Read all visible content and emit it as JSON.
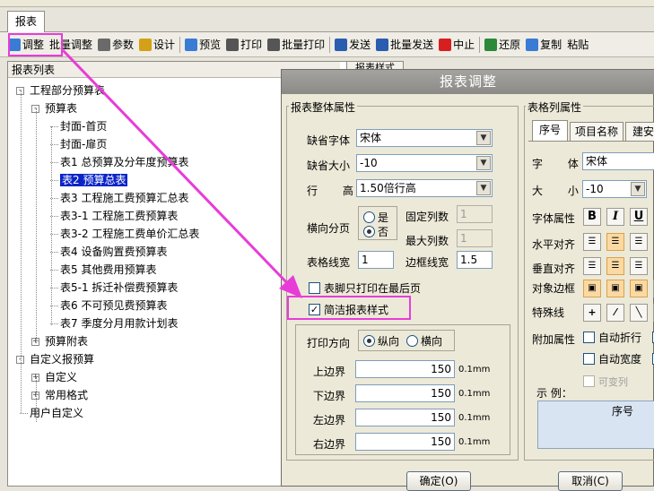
{
  "tab": {
    "title": "报表"
  },
  "toolbar": {
    "items": [
      {
        "label": "调整",
        "icon": "adjust-icon"
      },
      {
        "label": "批量调整",
        "icon": ""
      },
      {
        "label": "参数",
        "icon": "param-icon"
      },
      {
        "label": "设计",
        "icon": "pencil-icon"
      },
      {
        "label": "预览",
        "icon": "preview-icon"
      },
      {
        "label": "打印",
        "icon": "printer-icon"
      },
      {
        "label": "批量打印",
        "icon": "printer-icon"
      },
      {
        "label": "发送",
        "icon": "arrow-right-icon"
      },
      {
        "label": "批量发送",
        "icon": "double-arrow-icon"
      },
      {
        "label": "中止",
        "icon": "stop-icon"
      },
      {
        "label": "还原",
        "icon": "restore-icon"
      },
      {
        "label": "复制",
        "icon": "copy-icon"
      },
      {
        "label": "粘贴",
        "icon": ""
      }
    ]
  },
  "left": {
    "header": "报表列表",
    "tree": [
      {
        "label": "工程部分预算表",
        "level": 0,
        "exp": "-"
      },
      {
        "label": "预算表",
        "level": 1,
        "exp": "-"
      },
      {
        "label": "封面-首页",
        "level": 2,
        "exp": ""
      },
      {
        "label": "封面-扉页",
        "level": 2,
        "exp": ""
      },
      {
        "label": "表1 总预算及分年度预算表",
        "level": 2,
        "exp": ""
      },
      {
        "label": "表2 预算总表",
        "level": 2,
        "exp": "",
        "selected": true
      },
      {
        "label": "表3 工程施工费预算汇总表",
        "level": 2,
        "exp": ""
      },
      {
        "label": "表3-1 工程施工费预算表",
        "level": 2,
        "exp": ""
      },
      {
        "label": "表3-2 工程施工费单价汇总表",
        "level": 2,
        "exp": ""
      },
      {
        "label": "表4 设备购置费预算表",
        "level": 2,
        "exp": ""
      },
      {
        "label": "表5 其他费用预算表",
        "level": 2,
        "exp": ""
      },
      {
        "label": "表5-1 拆迁补偿费预算表",
        "level": 2,
        "exp": ""
      },
      {
        "label": "表6 不可预见费预算表",
        "level": 2,
        "exp": ""
      },
      {
        "label": "表7 季度分月用款计划表",
        "level": 2,
        "exp": ""
      },
      {
        "label": "预算附表",
        "level": 1,
        "exp": "+"
      },
      {
        "label": "自定义报预算",
        "level": 0,
        "exp": "-"
      },
      {
        "label": "自定义",
        "level": 1,
        "exp": "+"
      },
      {
        "label": "常用格式",
        "level": 1,
        "exp": "+"
      },
      {
        "label": "用户自定义",
        "level": 0,
        "exp": ""
      }
    ]
  },
  "righttab": "报表样式",
  "dialog": {
    "title": "报表调整",
    "whole": {
      "group": "报表整体属性",
      "font_label": "缺省字体",
      "font_value": "宋体",
      "size_label": "缺省大小",
      "size_value": "-10",
      "row_label": "行 高",
      "row_value": "1.50倍行高",
      "split_label": "横向分页",
      "yes": "是",
      "no": "否",
      "fixed_label": "固定列数",
      "fixed_value": "1",
      "max_label": "最大列数",
      "max_value": "1",
      "grid_label": "表格线宽",
      "grid_value": "1",
      "border_label": "边框线宽",
      "border_value": "1.5",
      "footer_label": "表脚只打印在最后页",
      "simple_label": "简洁报表样式",
      "dir_label": "打印方向",
      "portrait": "纵向",
      "landscape": "横向",
      "margins": [
        {
          "label": "上边界",
          "value": "150",
          "unit": "0.1mm"
        },
        {
          "label": "下边界",
          "value": "150",
          "unit": "0.1mm"
        },
        {
          "label": "左边界",
          "value": "150",
          "unit": "0.1mm"
        },
        {
          "label": "右边界",
          "value": "150",
          "unit": "0.1mm"
        }
      ]
    },
    "col": {
      "group": "表格列属性",
      "tabs": [
        "序号",
        "项目名称",
        "建安"
      ],
      "font_label": "字 体",
      "font_value": "宋体",
      "size_label": "大 小",
      "size_value": "-10",
      "style_label": "字体属性",
      "halign_label": "水平对齐",
      "valign_label": "垂直对齐",
      "frame_label": "对象边框",
      "special_label": "特殊线",
      "extra_label": "附加属性",
      "wrap_label": "自动折行",
      "autow_label": "自动宽度",
      "var_label": "可变列",
      "example_label": "示 例：",
      "example_col": "序号"
    },
    "ok": "确定(O)",
    "cancel": "取消(C)"
  },
  "annotation_color": "#e83cd8",
  "selection_color": "#0a24c8"
}
